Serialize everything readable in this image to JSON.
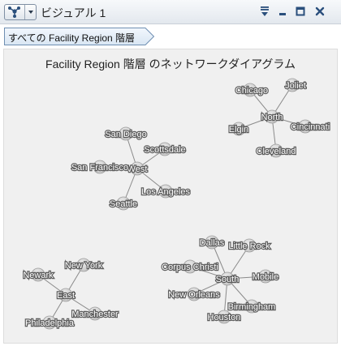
{
  "titlebar": {
    "title": "ビジュアル 1",
    "menu_icon": "network-graph-icon",
    "menu_dropdown_icon": "caret-down-icon",
    "actions": [
      "filter-menu-icon",
      "minimize-icon",
      "maximize-icon",
      "close-icon"
    ]
  },
  "breadcrumb": {
    "label": "すべての Facility Region 階層"
  },
  "chart_data": {
    "type": "network",
    "title": "Facility Region 階層 のネットワークダイアグラム",
    "node_color": "#c4c4c4",
    "edge_color": "#8a8a8a",
    "clusters": [
      {
        "hub": "North",
        "children": [
          "Chicago",
          "Joliet",
          "Elgin",
          "Cincinnati",
          "Cleveland"
        ]
      },
      {
        "hub": "West",
        "children": [
          "San Diego",
          "Scottsdale",
          "San Francisco",
          "Los Angeles",
          "Seattle"
        ]
      },
      {
        "hub": "East",
        "children": [
          "New York",
          "Newark",
          "Manchester",
          "Philadelphia"
        ]
      },
      {
        "hub": "South",
        "children": [
          "Dallas",
          "Little Rock",
          "Corpus Christi",
          "Mobile",
          "New Orleans",
          "Birmingham",
          "Houston"
        ]
      }
    ]
  }
}
